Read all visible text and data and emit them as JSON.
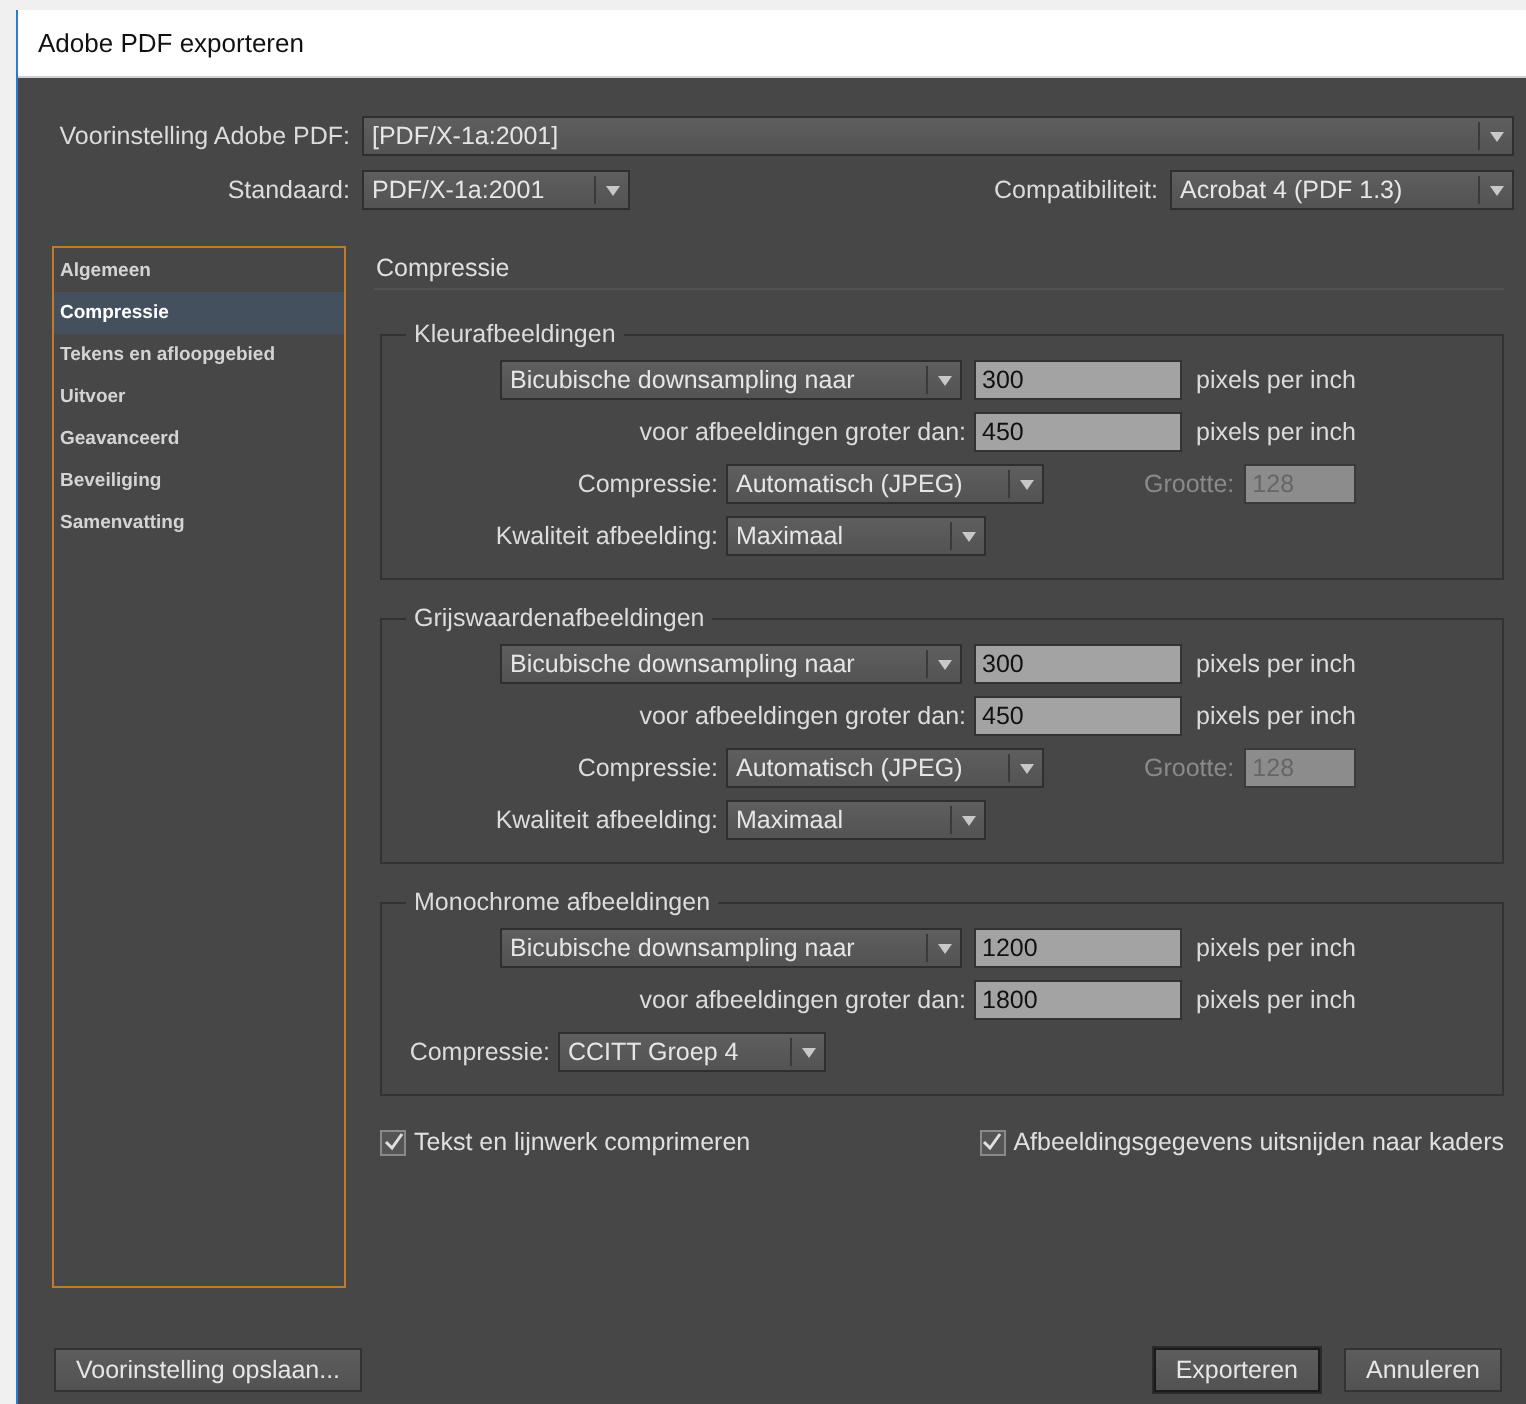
{
  "window": {
    "title": "Adobe PDF exporteren"
  },
  "preset": {
    "label": "Voorinstelling Adobe PDF:",
    "value": "[PDF/X-1a:2001]"
  },
  "standard": {
    "label": "Standaard:",
    "value": "PDF/X-1a:2001"
  },
  "compatibility": {
    "label": "Compatibiliteit:",
    "value": "Acrobat 4 (PDF 1.3)"
  },
  "sidebar": {
    "items": [
      {
        "label": "Algemeen",
        "selected": false
      },
      {
        "label": "Compressie",
        "selected": true
      },
      {
        "label": "Tekens en afloopgebied",
        "selected": false
      },
      {
        "label": "Uitvoer",
        "selected": false
      },
      {
        "label": "Geavanceerd",
        "selected": false
      },
      {
        "label": "Beveiliging",
        "selected": false
      },
      {
        "label": "Samenvatting",
        "selected": false
      }
    ]
  },
  "section_title": "Compressie",
  "groups": [
    {
      "title": "Kleurafbeeldingen",
      "rows": [
        {
          "kind": "downsample",
          "value": "Bicubische downsampling naar",
          "input": "300",
          "unit": "pixels per inch"
        },
        {
          "kind": "threshold",
          "label": "voor afbeeldingen groter dan:",
          "input": "450",
          "unit": "pixels per inch"
        },
        {
          "kind": "compression",
          "label": "Compressie:",
          "value": "Automatisch (JPEG)",
          "size_label": "Grootte:",
          "size_value": "128",
          "disabled": true
        },
        {
          "kind": "quality",
          "label": "Kwaliteit afbeelding:",
          "value": "Maximaal"
        }
      ]
    },
    {
      "title": "Grijswaardenafbeeldingen",
      "rows": [
        {
          "kind": "downsample",
          "value": "Bicubische downsampling naar",
          "input": "300",
          "unit": "pixels per inch"
        },
        {
          "kind": "threshold",
          "label": "voor afbeeldingen groter dan:",
          "input": "450",
          "unit": "pixels per inch"
        },
        {
          "kind": "compression",
          "label": "Compressie:",
          "value": "Automatisch (JPEG)",
          "size_label": "Grootte:",
          "size_value": "128",
          "disabled": true
        },
        {
          "kind": "quality",
          "label": "Kwaliteit afbeelding:",
          "value": "Maximaal"
        }
      ]
    },
    {
      "title": "Monochrome afbeeldingen",
      "rows": [
        {
          "kind": "downsample",
          "value": "Bicubische downsampling naar",
          "input": "1200",
          "unit": "pixels per inch"
        },
        {
          "kind": "threshold",
          "label": "voor afbeeldingen groter dan:",
          "input": "1800",
          "unit": "pixels per inch"
        },
        {
          "kind": "mono_compression",
          "label": "Compressie:",
          "value": "CCITT Groep 4"
        }
      ]
    }
  ],
  "checkboxes": [
    {
      "label": "Tekst en lijnwerk comprimeren",
      "checked": true
    },
    {
      "label": "Afbeeldingsgegevens uitsnijden naar kaders",
      "checked": true
    }
  ],
  "buttons": [
    {
      "label": "Voorinstelling opslaan...",
      "kind": "secondary"
    },
    {
      "label": "Exporteren",
      "kind": "default"
    },
    {
      "label": "Annuleren",
      "kind": "secondary"
    }
  ]
}
